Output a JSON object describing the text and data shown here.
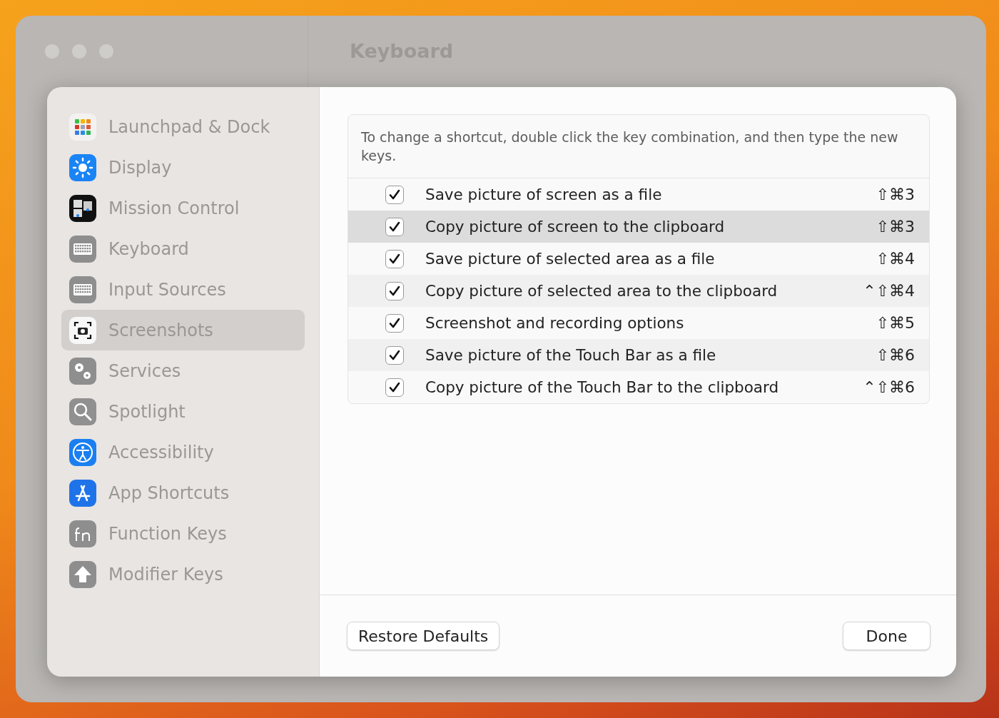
{
  "window": {
    "title": "Keyboard"
  },
  "sidebar": {
    "items": [
      {
        "label": "Launchpad & Dock",
        "selected": false
      },
      {
        "label": "Display",
        "selected": false
      },
      {
        "label": "Mission Control",
        "selected": false
      },
      {
        "label": "Keyboard",
        "selected": false
      },
      {
        "label": "Input Sources",
        "selected": false
      },
      {
        "label": "Screenshots",
        "selected": true
      },
      {
        "label": "Services",
        "selected": false
      },
      {
        "label": "Spotlight",
        "selected": false
      },
      {
        "label": "Accessibility",
        "selected": false
      },
      {
        "label": "App Shortcuts",
        "selected": false
      },
      {
        "label": "Function Keys",
        "selected": false
      },
      {
        "label": "Modifier Keys",
        "selected": false
      }
    ]
  },
  "shortcuts": {
    "hint": "To change a shortcut, double click the key combination, and then type the new keys.",
    "rows": [
      {
        "checked": true,
        "label": "Save picture of screen as a file",
        "keys": "⇧⌘3",
        "selected": false
      },
      {
        "checked": true,
        "label": "Copy picture of screen to the clipboard",
        "keys": "⇧⌘3",
        "selected": true
      },
      {
        "checked": true,
        "label": "Save picture of selected area as a file",
        "keys": "⇧⌘4",
        "selected": false
      },
      {
        "checked": true,
        "label": "Copy picture of selected area to the clipboard",
        "keys": "⌃⇧⌘4",
        "selected": false
      },
      {
        "checked": true,
        "label": "Screenshot and recording options",
        "keys": "⇧⌘5",
        "selected": false
      },
      {
        "checked": true,
        "label": "Save picture of the Touch Bar as a file",
        "keys": "⇧⌘6",
        "selected": false
      },
      {
        "checked": true,
        "label": "Copy picture of the Touch Bar to the clipboard",
        "keys": "⌃⇧⌘6",
        "selected": false
      }
    ]
  },
  "buttons": [
    "Restore Defaults",
    "Done"
  ]
}
